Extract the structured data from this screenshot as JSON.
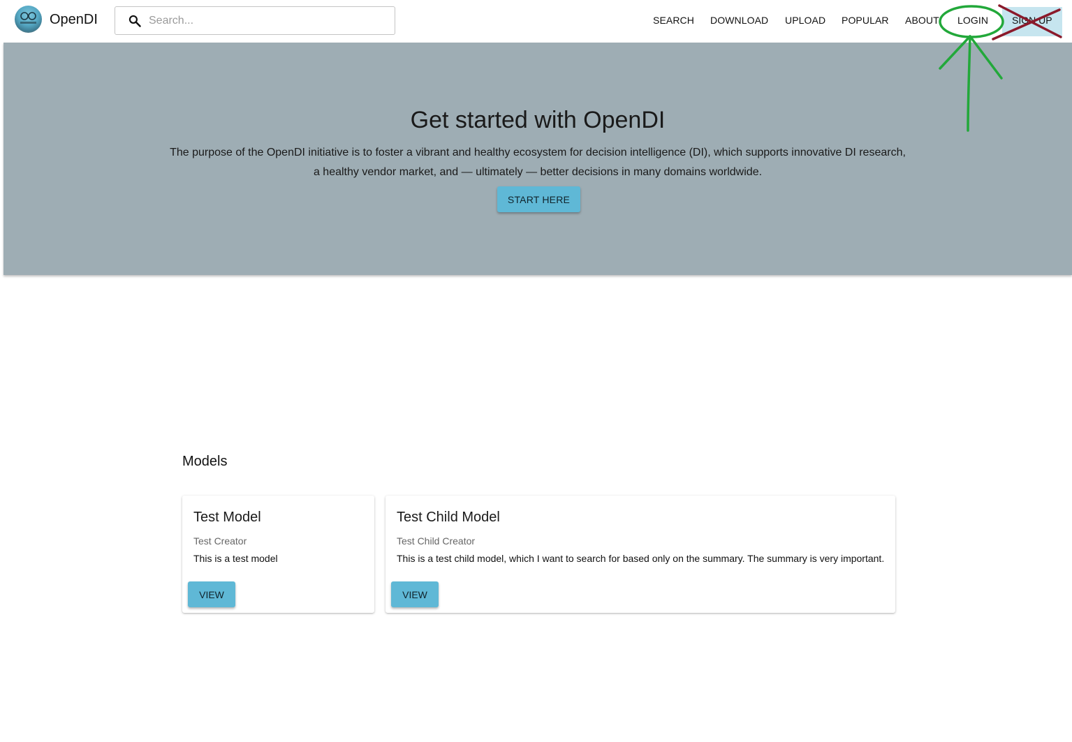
{
  "header": {
    "brand": "OpenDI",
    "logo_icon": "opendi-logo-icon",
    "search": {
      "placeholder": "Search...",
      "value": "",
      "icon": "search-icon"
    },
    "nav": [
      "SEARCH",
      "DOWNLOAD",
      "UPLOAD",
      "POPULAR",
      "ABOUT",
      "LOGIN"
    ],
    "signup_label": "SIGN UP"
  },
  "hero": {
    "title": "Get started with OpenDI",
    "text_line1": "The purpose of the OpenDI initiative is to foster a vibrant and healthy ecosystem for decision intelligence (DI), which supports innovative DI research,",
    "text_line2": "a healthy vendor market, and — ultimately — better decisions in many domains worldwide.",
    "button_label": "START HERE"
  },
  "models": {
    "section_title": "Models",
    "cards": [
      {
        "title": "Test Model",
        "creator": "Test Creator",
        "summary": "This is a test model",
        "button_label": "VIEW"
      },
      {
        "title": "Test Child Model",
        "creator": "Test Child Creator",
        "summary": "This is a test child model, which I want to search for based only on the summary. The summary is very important.",
        "button_label": "VIEW"
      }
    ]
  },
  "colors": {
    "hero_bg": "#9eadb4",
    "button_bg": "#5fb8d6",
    "signup_bg": "#c6e5ef",
    "annotation_green": "#22a83a",
    "annotation_red": "#8b1a2b"
  }
}
